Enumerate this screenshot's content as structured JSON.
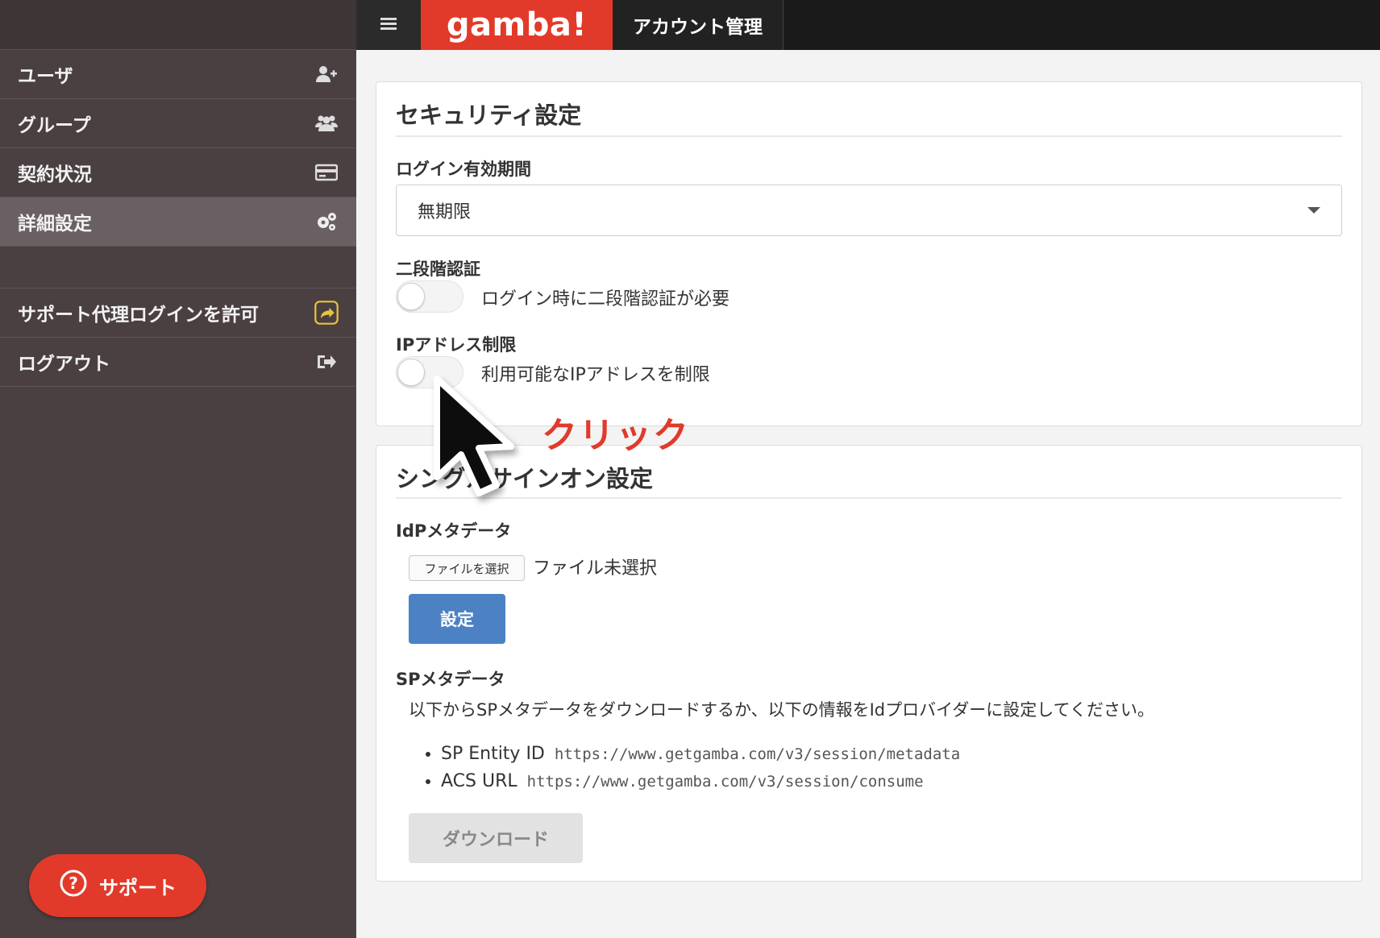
{
  "header": {
    "logo_text": "gamba!",
    "title": "アカウント管理",
    "menu_icon": "hamburger-icon"
  },
  "sidebar": {
    "items": [
      {
        "label": "ユーザ",
        "icon": "add-user-icon"
      },
      {
        "label": "グループ",
        "icon": "group-icon"
      },
      {
        "label": "契約状況",
        "icon": "credit-card-icon"
      },
      {
        "label": "詳細設定",
        "icon": "gears-icon",
        "active": true
      },
      {
        "label": "サポート代理ログインを許可",
        "icon": "share-icon"
      },
      {
        "label": "ログアウト",
        "icon": "logout-icon"
      }
    ],
    "support_button": "サポート"
  },
  "security": {
    "title": "セキュリティ設定",
    "login_period_label": "ログイン有効期間",
    "login_period_value": "無期限",
    "two_factor_label": "二段階認証",
    "two_factor_text": "ログイン時に二段階認証が必要",
    "ip_label": "IPアドレス制限",
    "ip_text": "利用可能なIPアドレスを制限"
  },
  "sso": {
    "title": "シングルサインオン設定",
    "idp_label": "IdPメタデータ",
    "file_button": "ファイルを選択",
    "file_status": "ファイル未選択",
    "set_button": "設定",
    "sp_label": "SPメタデータ",
    "sp_description": "以下からSPメタデータをダウンロードするか、以下の情報をIdプロバイダーに設定してください。",
    "entity_id_label": "SP Entity ID",
    "entity_id_value": "https://www.getgamba.com/v3/session/metadata",
    "acs_label": "ACS URL",
    "acs_value": "https://www.getgamba.com/v3/session/consume",
    "download_button": "ダウンロード"
  },
  "annotation": {
    "click_text": "クリック"
  },
  "colors": {
    "brand_red": "#e23a2a",
    "sidebar_bg": "#4a4042",
    "primary_blue": "#4c82c4"
  }
}
